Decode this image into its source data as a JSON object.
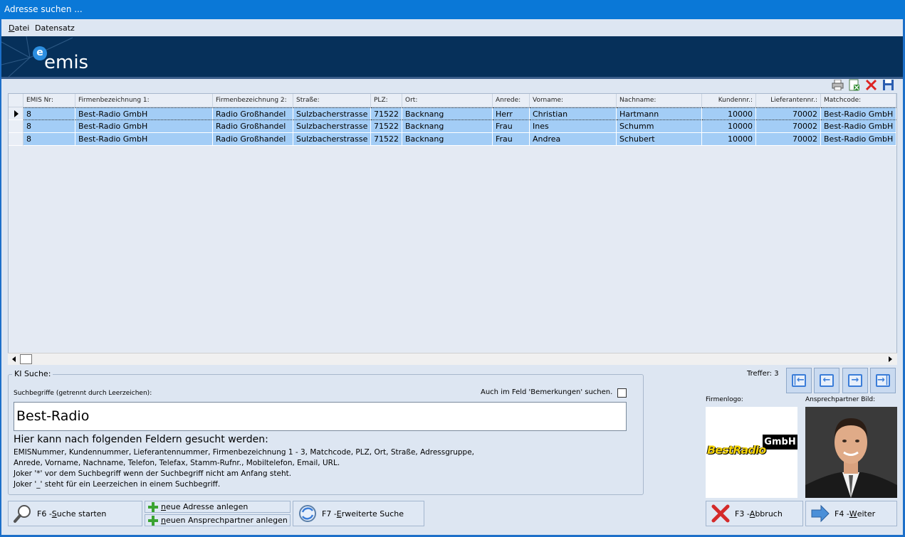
{
  "window": {
    "title": "Adresse suchen ..."
  },
  "menu": {
    "items": [
      "Datei",
      "Datensatz"
    ]
  },
  "banner": {
    "brand": "emis",
    "brand_mark": "e"
  },
  "grid": {
    "columns": [
      "EMIS Nr:",
      "Firmenbezeichnung 1:",
      "Firmenbezeichnung 2:",
      "Straße:",
      "PLZ:",
      "Ort:",
      "Anrede:",
      "Vorname:",
      "Nachname:",
      "Kundennr.:",
      "Lieferantennr.:",
      "Matchcode:"
    ],
    "rows": [
      [
        "8",
        "Best-Radio GmbH",
        "Radio Großhandel",
        "Sulzbacherstrasse",
        "71522",
        "Backnang",
        "Herr",
        "Christian",
        "Hartmann",
        "10000",
        "70002",
        "Best-Radio GmbH"
      ],
      [
        "8",
        "Best-Radio GmbH",
        "Radio Großhandel",
        "Sulzbacherstrasse",
        "71522",
        "Backnang",
        "Frau",
        "Ines",
        "Schumm",
        "10000",
        "70002",
        "Best-Radio GmbH"
      ],
      [
        "8",
        "Best-Radio GmbH",
        "Radio Großhandel",
        "Sulzbacherstrasse",
        "71522",
        "Backnang",
        "Frau",
        "Andrea",
        "Schubert",
        "10000",
        "70002",
        "Best-Radio GmbH"
      ]
    ],
    "selected_row": 0
  },
  "search": {
    "group_label": "KI Suche:",
    "terms_label": "Suchbegriffe (getrennt durch Leerzeichen):",
    "remarks_label": "Auch im Feld 'Bemerkungen' suchen.",
    "remarks_checked": false,
    "value": "Best-Radio",
    "info_heading": "Hier kann nach folgenden Feldern gesucht werden:",
    "info_lines": [
      "EMISNummer, Kundennummer, Lieferantennummer, Firmenbezeichnung 1 - 3, Matchcode, PLZ, Ort, Straße, Adressgruppe,",
      "Anrede, Vorname, Nachname, Telefon, Telefax, Stamm-Rufnr., Mobiltelefon, Email, URL.",
      "Joker '*' vor dem Suchbegriff wenn der Suchbegriff nicht am Anfang steht.",
      "Joker '_' steht für ein Leerzeichen in einem Suchbegriff."
    ]
  },
  "results": {
    "treffer": "Treffer: 3"
  },
  "images": {
    "firmenlogo_label": "Firmenlogo:",
    "ansprech_label": "Ansprechpartner Bild:",
    "logo_word": "BestRadio",
    "logo_suffix": "GmbH"
  },
  "buttons": {
    "suche_starten": {
      "prefix": "F6 - ",
      "hotkey": "S",
      "rest": "uche starten"
    },
    "neue_adresse": {
      "hotkey": "n",
      "rest": "eue Adresse anlegen"
    },
    "neuer_ansprechpartner": {
      "hotkey": "n",
      "rest": "euen Ansprechpartner anlegen"
    },
    "erweiterte_suche": {
      "prefix": "F7 - ",
      "hotkey": "E",
      "rest": "rweiterte Suche"
    },
    "abbruch": {
      "prefix": "F3 - ",
      "hotkey": "A",
      "rest": "bbruch"
    },
    "weiter": {
      "prefix": "F4 - ",
      "hotkey": "W",
      "rest": "eiter"
    }
  },
  "colors": {
    "title_bar": "#0a78d7",
    "banner": "#06305a",
    "row_highlight": "#a3cdf6",
    "background": "#dde6f2"
  }
}
